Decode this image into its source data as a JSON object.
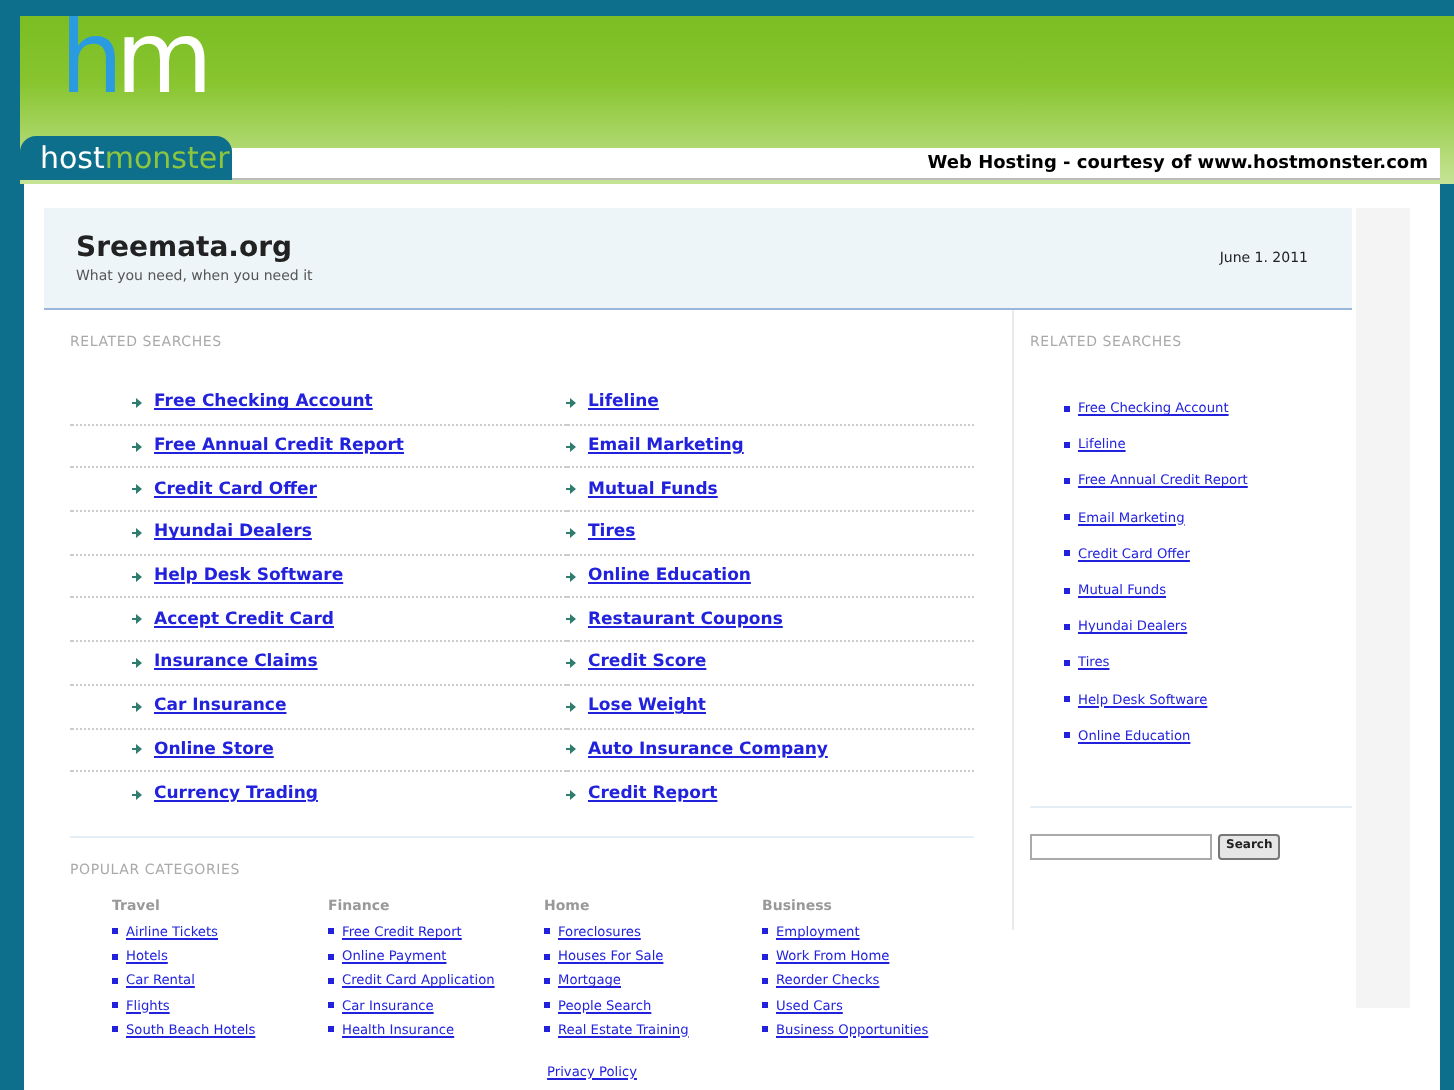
{
  "logo": {
    "mark": "hm",
    "name": [
      "host",
      "monster"
    ]
  },
  "banner": "Web Hosting - courtesy of www.hostmonster.com",
  "site": {
    "title": "Sreemata.org",
    "tagline": "What you need, when you need it",
    "date": "June 1. 2011"
  },
  "related": {
    "heading": "RELATED SEARCHES",
    "links": [
      "Free Checking Account",
      "Lifeline",
      "Free Annual Credit Report",
      "Email Marketing",
      "Credit Card Offer",
      "Mutual Funds",
      "Hyundai Dealers",
      "Tires",
      "Help Desk Software",
      "Online Education",
      "Accept Credit Card",
      "Restaurant Coupons",
      "Insurance Claims",
      "Credit Score",
      "Car Insurance",
      "Lose Weight",
      "Online Store",
      "Auto Insurance Company",
      "Currency Trading",
      "Credit Report"
    ]
  },
  "popular": {
    "heading": "POPULAR CATEGORIES",
    "categories": [
      {
        "name": "Travel",
        "links": [
          "Airline Tickets",
          "Hotels",
          "Car Rental",
          "Flights",
          "South Beach Hotels"
        ]
      },
      {
        "name": "Finance",
        "links": [
          "Free Credit Report",
          "Online Payment",
          "Credit Card Application",
          "Car Insurance",
          "Health Insurance"
        ]
      },
      {
        "name": "Home",
        "links": [
          "Foreclosures",
          "Houses For Sale",
          "Mortgage",
          "People Search",
          "Real Estate Training"
        ]
      },
      {
        "name": "Business",
        "links": [
          "Employment",
          "Work From Home",
          "Reorder Checks",
          "Used Cars",
          "Business Opportunities"
        ]
      }
    ]
  },
  "sidebar": {
    "heading": "RELATED SEARCHES",
    "links": [
      "Free Checking Account",
      "Lifeline",
      "Free Annual Credit Report",
      "Email Marketing",
      "Credit Card Offer",
      "Mutual Funds",
      "Hyundai Dealers",
      "Tires",
      "Help Desk Software",
      "Online Education"
    ],
    "search_button": "Search"
  },
  "footer": {
    "link": "Privacy Policy"
  }
}
